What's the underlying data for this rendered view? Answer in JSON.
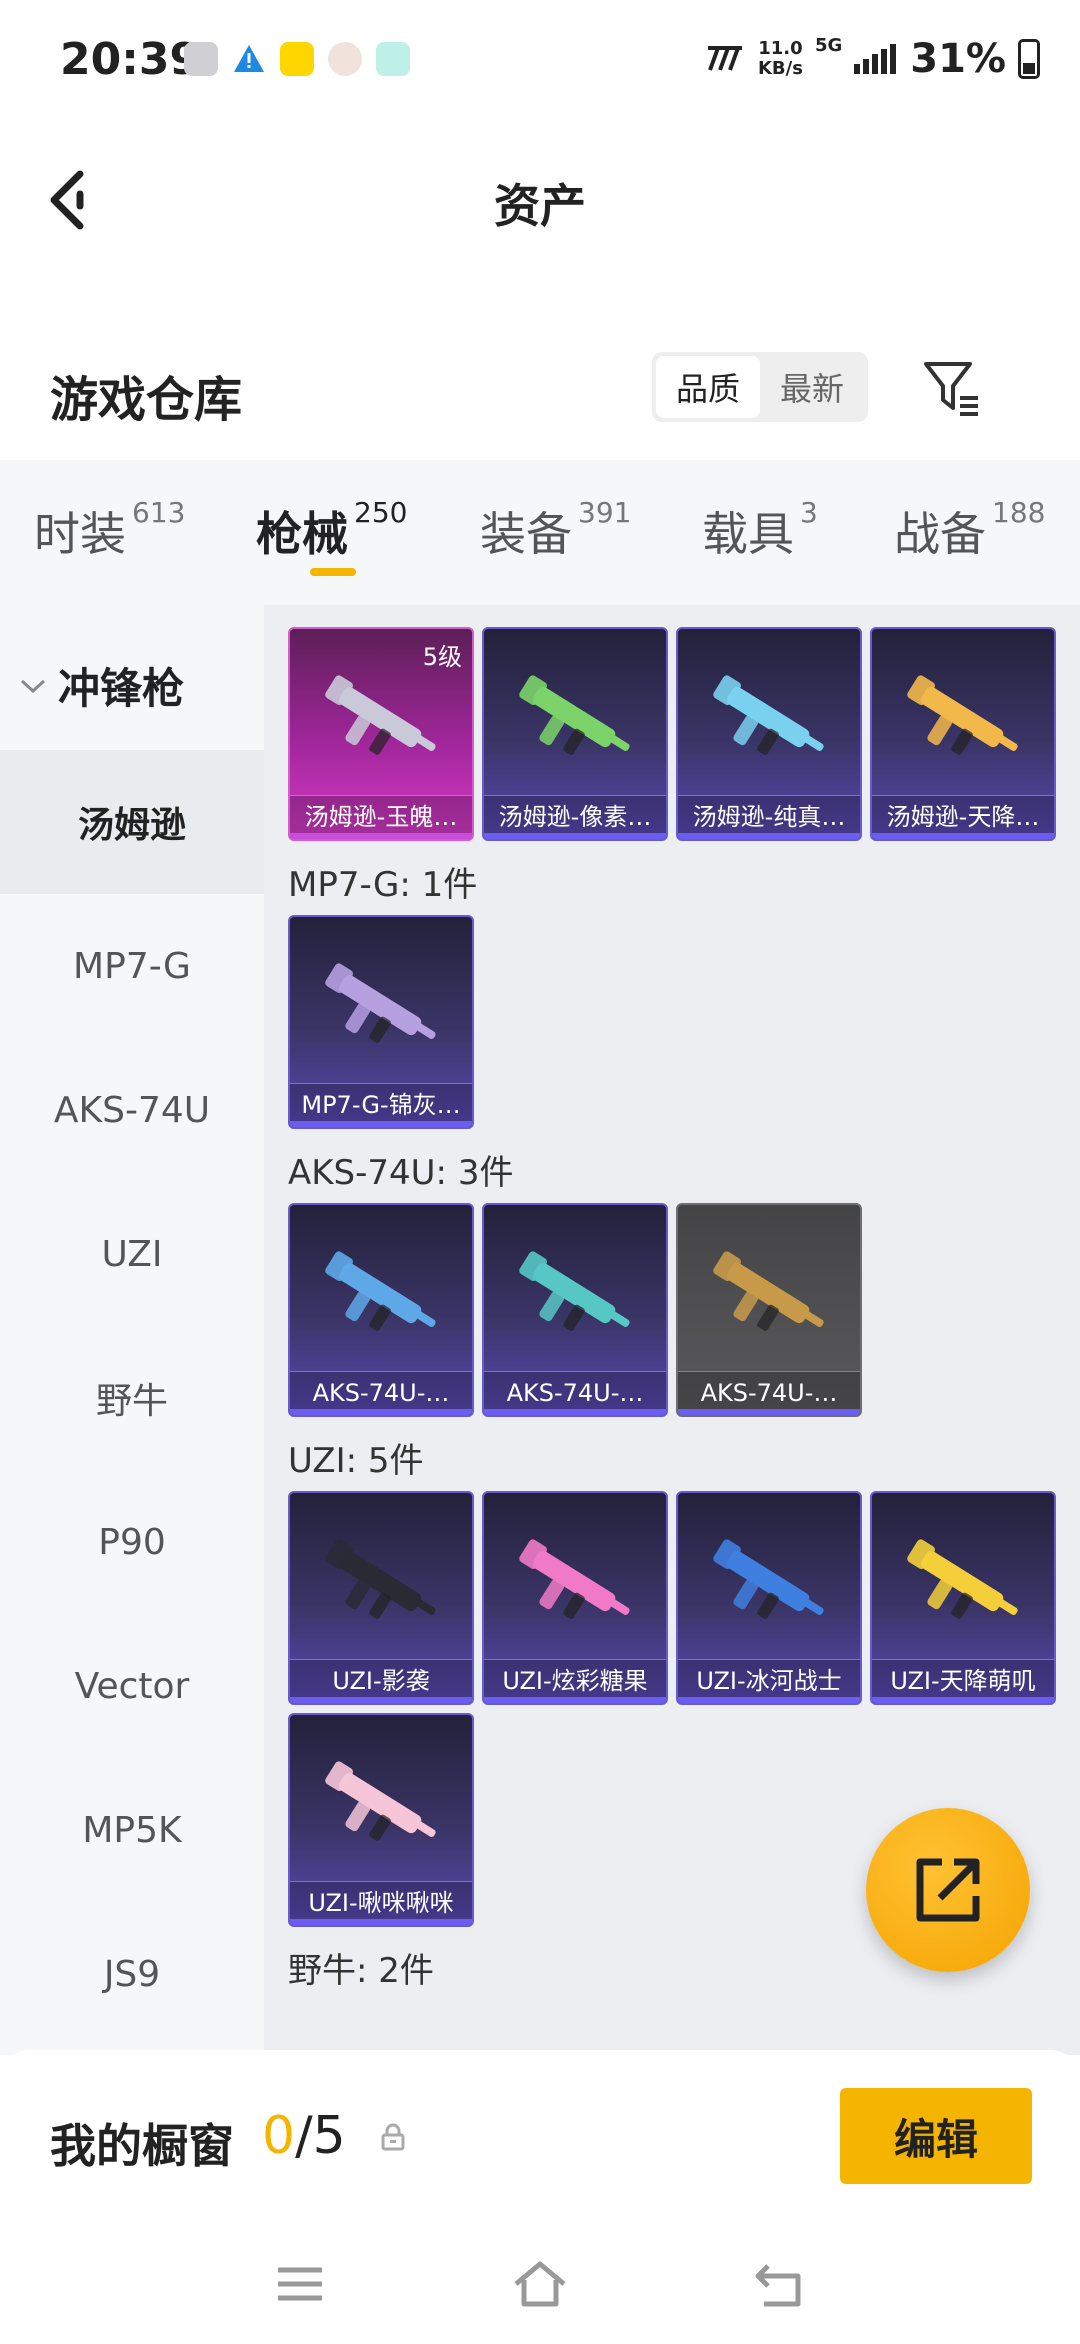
{
  "status": {
    "time": "20:39",
    "speed_value": "11.0",
    "speed_unit": "KB/s",
    "network": "5G",
    "battery": "31%"
  },
  "header": {
    "title": "资产"
  },
  "warehouse": {
    "title": "游戏仓库",
    "sort_options": [
      "品质",
      "最新"
    ],
    "sort_selected": "品质"
  },
  "tabs": [
    {
      "label": "时装",
      "count": "613"
    },
    {
      "label": "枪械",
      "count": "250"
    },
    {
      "label": "装备",
      "count": "391"
    },
    {
      "label": "载具",
      "count": "3"
    },
    {
      "label": "战备",
      "count": "188"
    }
  ],
  "active_tab": "枪械",
  "sidebar": {
    "category": "冲锋枪",
    "items": [
      "汤姆逊",
      "MP7-G",
      "AKS-74U",
      "UZI",
      "野牛",
      "P90",
      "Vector",
      "MP5K",
      "JS9"
    ],
    "active": "汤姆逊"
  },
  "groups": [
    {
      "title": "",
      "items": [
        {
          "name": "汤姆逊-玉魄…",
          "level": "5级",
          "style": "pink",
          "color": "#c9c9d9"
        },
        {
          "name": "汤姆逊-像素…",
          "style": "purple",
          "color": "#7cd36a"
        },
        {
          "name": "汤姆逊-纯真…",
          "style": "purple",
          "color": "#7ad0ef"
        },
        {
          "name": "汤姆逊-天降…",
          "style": "purple",
          "color": "#f2b84a"
        }
      ]
    },
    {
      "title": "MP7-G: 1件",
      "items": [
        {
          "name": "MP7-G-锦灰…",
          "style": "purple",
          "color": "#b6a0e0"
        }
      ]
    },
    {
      "title": "AKS-74U: 3件",
      "items": [
        {
          "name": "AKS-74U-…",
          "style": "purple",
          "color": "#5fa8e8"
        },
        {
          "name": "AKS-74U-…",
          "style": "purple",
          "color": "#57c7c5"
        },
        {
          "name": "AKS-74U-…",
          "style": "gray",
          "color": "#c79a4a"
        }
      ]
    },
    {
      "title": "UZI: 5件",
      "items": [
        {
          "name": "UZI-影袭",
          "style": "purple",
          "color": "#2a2a35"
        },
        {
          "name": "UZI-炫彩糖果",
          "style": "purple",
          "color": "#f07ac8"
        },
        {
          "name": "UZI-冰河战士",
          "style": "purple",
          "color": "#3f7fe0"
        },
        {
          "name": "UZI-天降萌叽",
          "style": "purple",
          "color": "#f4cf3a"
        },
        {
          "name": "UZI-啾咪啾咪",
          "style": "purple",
          "color": "#f6c6d8"
        }
      ]
    },
    {
      "title": "野牛: 2件",
      "items": []
    }
  ],
  "showcase": {
    "title": "我的橱窗",
    "current": "0",
    "separator_total": "/5",
    "edit_label": "编辑"
  },
  "colors": {
    "accent": "#f5b400",
    "card_purple": "#5a49b4",
    "card_pink": "#d53cc8"
  }
}
